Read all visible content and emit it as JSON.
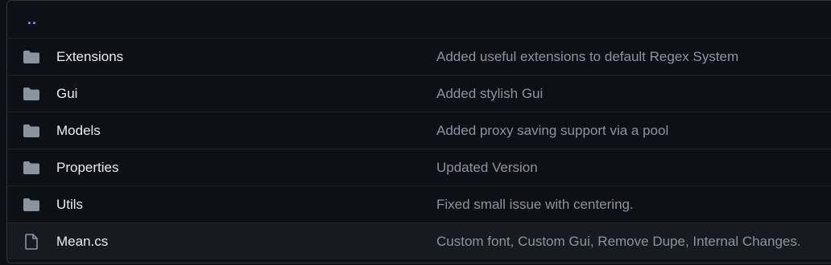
{
  "up_link": "..",
  "entries": [
    {
      "type": "folder",
      "name": "Extensions",
      "message": "Added useful extensions to default Regex System"
    },
    {
      "type": "folder",
      "name": "Gui",
      "message": "Added stylish Gui"
    },
    {
      "type": "folder",
      "name": "Models",
      "message": "Added proxy saving support via a pool"
    },
    {
      "type": "folder",
      "name": "Properties",
      "message": "Updated Version"
    },
    {
      "type": "folder",
      "name": "Utils",
      "message": "Fixed small issue with centering."
    },
    {
      "type": "file",
      "name": "Mean.cs",
      "message": "Custom font, Custom Gui, Remove Dupe, Internal Changes."
    }
  ],
  "colors": {
    "background": "#0d1117",
    "border": "#30363d",
    "row_divider": "#21262d",
    "hover_row": "#161b22",
    "link": "#58a6ff",
    "name_text": "#e6edf3",
    "message_text": "#8b949e",
    "icon": "#8b949e"
  },
  "icons": {
    "folder": "folder-icon",
    "file": "file-icon"
  }
}
